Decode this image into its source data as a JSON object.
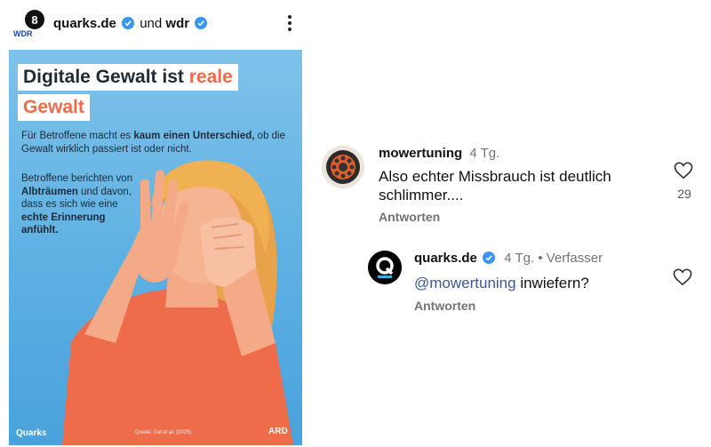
{
  "post_header": {
    "account": "quarks.de",
    "connector": "und",
    "collaborator": "wdr",
    "avatar_label": "WDR"
  },
  "poster": {
    "title_part1": "Digitale Gewalt ist",
    "title_highlight": "reale",
    "title_line2": "Gewalt",
    "para1_a": "Für Betroffene macht es ",
    "para1_b": "kaum einen Unterschied,",
    "para1_c": " ob die Gewalt wirklich passiert ist oder nicht.",
    "para2_a": "Betroffene berichten von ",
    "para2_b": "Albträumen",
    "para2_c": " und davon, dass es sich wie eine ",
    "para2_d": "echte Erinnerung anfühlt.",
    "logo_left": "Quarks",
    "source": "Quelle: Dal et al. (2025)",
    "logo_right": "ARD"
  },
  "comments": [
    {
      "username": "mowertuning",
      "time": "4 Tg.",
      "text": "Also echter Missbrauch ist deutlich schlimmer....",
      "reply_label": "Antworten",
      "likes": "29"
    },
    {
      "username": "quarks.de",
      "time": "4 Tg.",
      "separator": "•",
      "role": "Verfasser",
      "mention": "@mowertuning",
      "text": " inwiefern?",
      "reply_label": "Antworten"
    }
  ],
  "colors": {
    "accent": "#ef6c4a",
    "verified": "#3897f0",
    "mention": "#3b5998",
    "poster_bg": "#5aaee2"
  }
}
